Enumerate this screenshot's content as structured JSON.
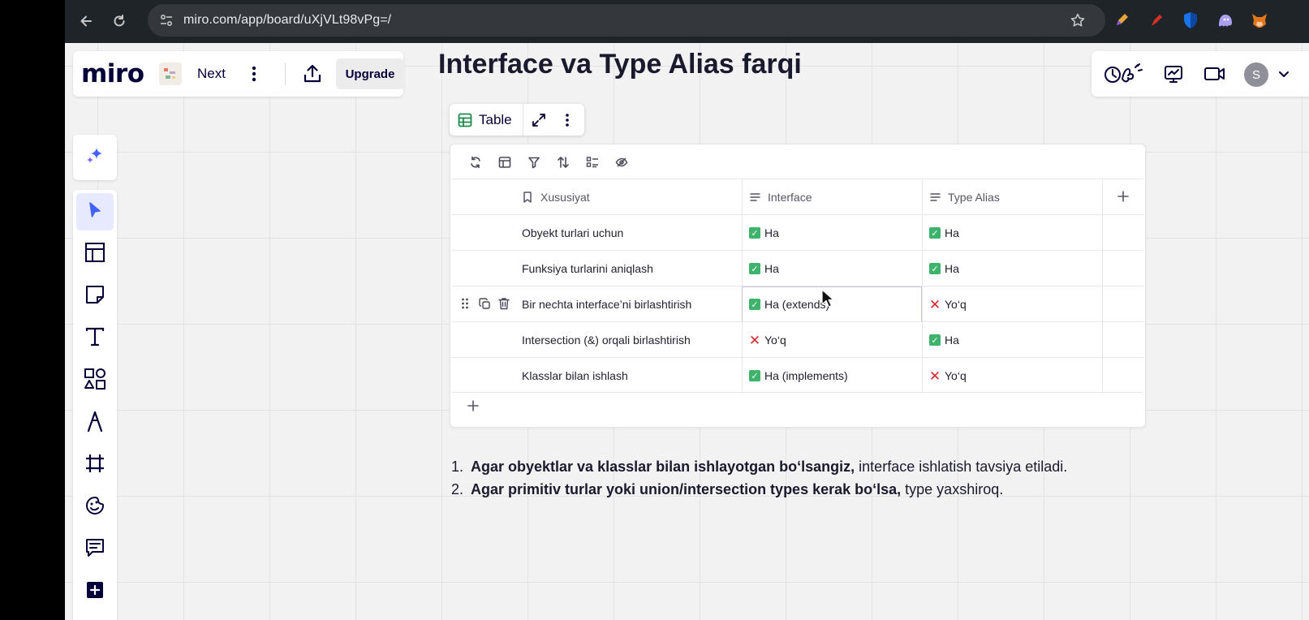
{
  "browser": {
    "url": "miro.com/app/board/uXjVLt98vPg=/"
  },
  "header": {
    "logo": "miro",
    "board_name": "Next",
    "upgrade_label": "Upgrade",
    "avatar_initial": "S"
  },
  "title": "Interface va Type Alias farqi",
  "table_widget": {
    "chip_label": "Table",
    "headers": {
      "property": "Xususiyat",
      "interface": "Interface",
      "type_alias": "Type Alias"
    },
    "rows": [
      {
        "property": "Obyekt turlari uchun",
        "interface": "Ha",
        "interface_status": "yes",
        "type_alias": "Ha",
        "type_alias_status": "yes"
      },
      {
        "property": "Funksiya turlarini aniqlash",
        "interface": "Ha",
        "interface_status": "yes",
        "type_alias": "Ha",
        "type_alias_status": "yes"
      },
      {
        "property": "Bir nechta interface’ni birlashtirish",
        "interface": "Ha (extends)",
        "interface_status": "yes",
        "type_alias": "Yo‘q",
        "type_alias_status": "no"
      },
      {
        "property": "Intersection (&) orqali birlashtirish",
        "interface": "Yo‘q",
        "interface_status": "no",
        "type_alias": "Ha",
        "type_alias_status": "yes"
      },
      {
        "property": "Klasslar bilan ishlash",
        "interface": "Ha (implements)",
        "interface_status": "yes",
        "type_alias": "Yo‘q",
        "type_alias_status": "no"
      }
    ]
  },
  "notes": [
    {
      "number": "1.",
      "bold": "Agar obyektlar va klasslar bilan ishlayotgan bo‘lsangiz,",
      "rest": " interface ishlatish tavsiya etiladi."
    },
    {
      "number": "2.",
      "bold": "Agar primitiv turlar yoki union/intersection types kerak bo‘lsa,",
      "rest": " type yaxshiroq."
    }
  ],
  "colors": {
    "accent": "#4262ff",
    "check_green": "#3db36b",
    "cross_red": "#d8282f"
  }
}
